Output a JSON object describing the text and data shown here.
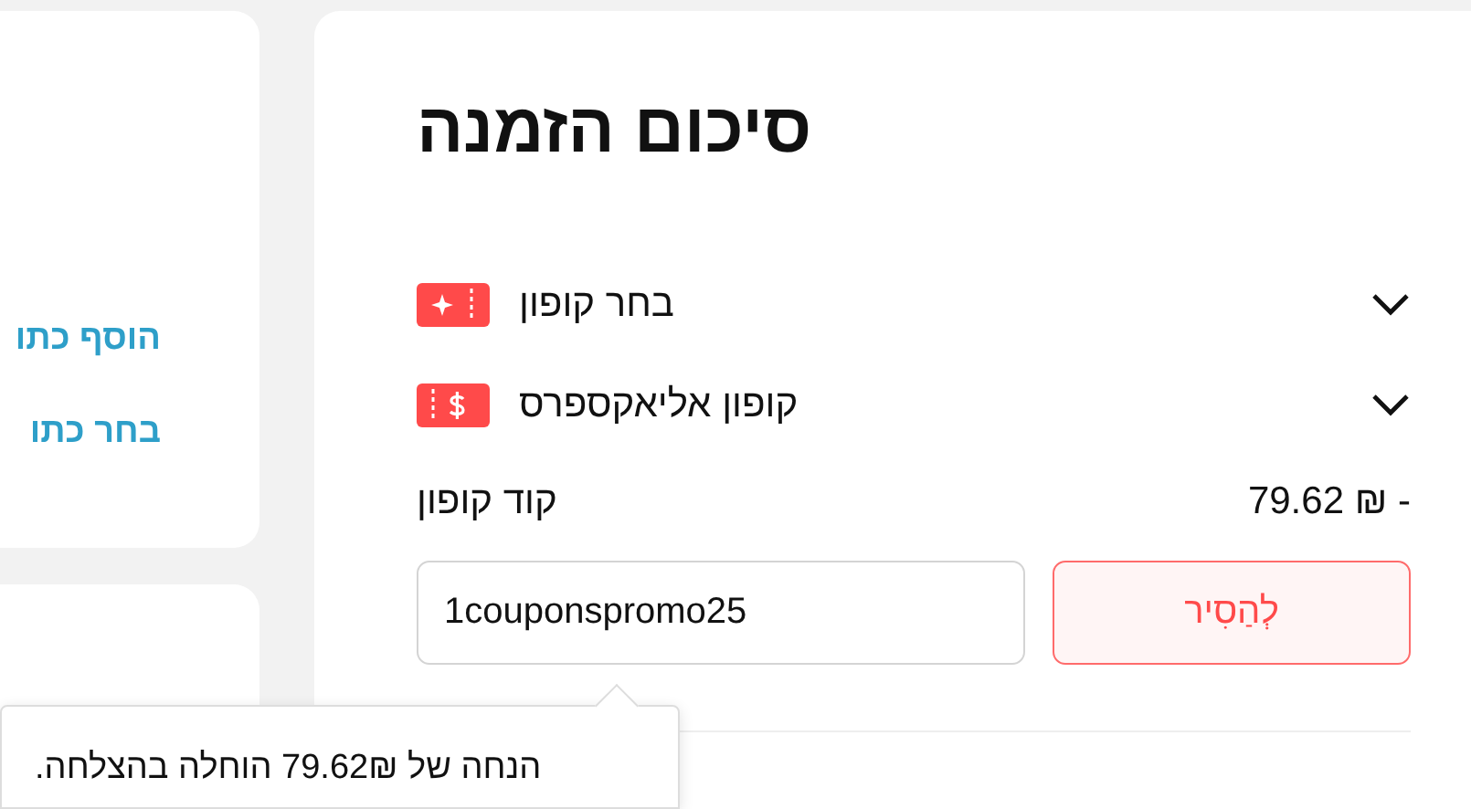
{
  "sidebar": {
    "links": [
      "הוסף כתו",
      "בחר כתו"
    ]
  },
  "summary": {
    "title": "סיכום הזמנה",
    "coupon_rows": [
      {
        "kind": "choose",
        "label": "בחר קופון",
        "expanded": false
      },
      {
        "kind": "store",
        "label": "קופון אליאקספרס",
        "expanded": false
      }
    ],
    "coupon_code": {
      "label": "קוד קופון",
      "discount": "79.62 ₪ -",
      "value": "1couponspromo25",
      "remove_button": "לְהַסִיר"
    }
  },
  "toast": {
    "message": "הנחה של 79.62₪ הוחלה בהצלחה."
  }
}
